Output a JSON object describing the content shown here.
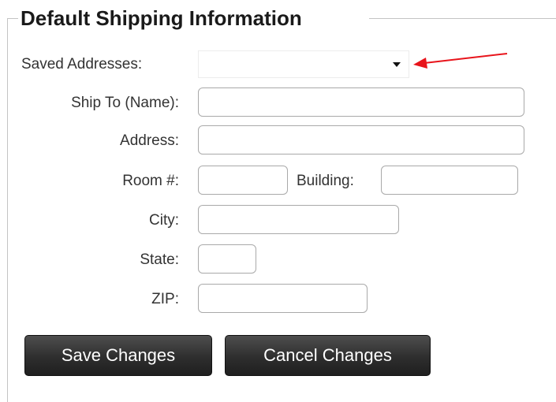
{
  "section": {
    "title": "Default Shipping Information"
  },
  "form": {
    "saved_addresses": {
      "label": "Saved Addresses:",
      "value": ""
    },
    "ship_to": {
      "label": "Ship To (Name):",
      "value": ""
    },
    "address": {
      "label": "Address:",
      "value": ""
    },
    "room": {
      "label": "Room #:",
      "value": ""
    },
    "building": {
      "label": "Building:",
      "value": ""
    },
    "city": {
      "label": "City:",
      "value": ""
    },
    "state": {
      "label": "State:",
      "value": ""
    },
    "zip": {
      "label": "ZIP:",
      "value": ""
    }
  },
  "buttons": {
    "save_label": "Save Changes",
    "cancel_label": "Cancel Changes"
  },
  "colors": {
    "annotation_arrow": "#e8141b",
    "button_background": "#2e2e2e",
    "button_text": "#ffffff",
    "field_border": "#a9a9a9"
  },
  "icons": {
    "dropdown": "chevron-down-icon",
    "annotation": "red-arrow-annotation"
  }
}
